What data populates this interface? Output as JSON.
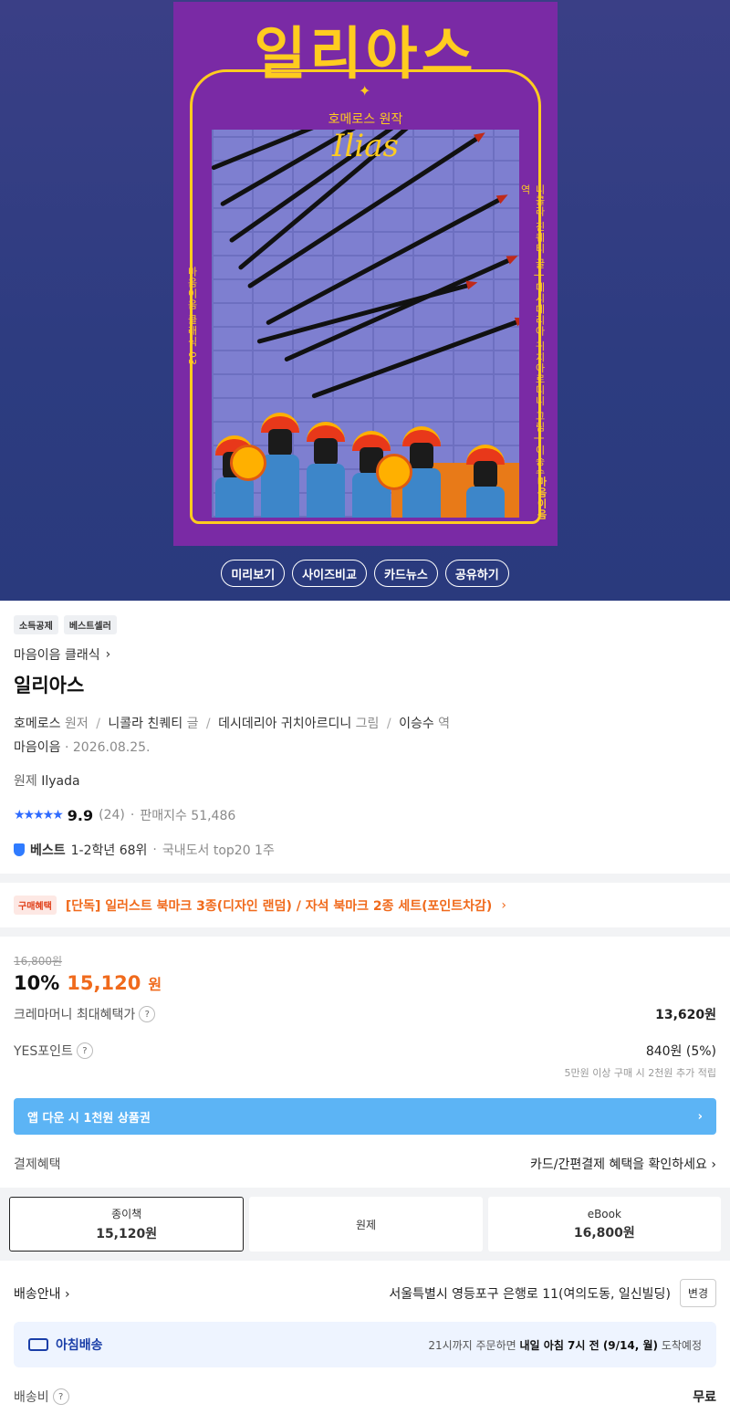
{
  "cover": {
    "title": "일리아스",
    "subtitle": "호메로스 원작",
    "latin_title": "Ilias",
    "spine_left": "마음이음 클래식 03",
    "spine_right": "니콜라 친퀘티 글 | 데시데리아 귀치아르디니 그림 | 이승수 역",
    "publisher_mark": "마음이음"
  },
  "hero_buttons": [
    "미리보기",
    "사이즈비교",
    "카드뉴스",
    "공유하기"
  ],
  "badges": [
    "소득공제",
    "베스트셀러"
  ],
  "series": "마음이음 클래식",
  "title": "일리아스",
  "authors": [
    {
      "name": "호메로스",
      "role": "원저"
    },
    {
      "name": "니콜라 친퀘티",
      "role": "글"
    },
    {
      "name": "데시데리아 귀치아르디니",
      "role": "그림"
    },
    {
      "name": "이승수",
      "role": "역"
    }
  ],
  "publisher": "마음이음",
  "pub_date": "2026.08.25.",
  "original_label": "원제",
  "original_title": "Ilyada",
  "rating": {
    "score": "9.9",
    "count": "(24)",
    "sales_label": "판매지수 51,486"
  },
  "bestseller": {
    "label": "베스트",
    "rank": "1-2학년 68위",
    "extra": "국내도서 top20 1주"
  },
  "benefit": {
    "tag": "구매혜택",
    "text": "[단독] 일러스트 북마크 3종(디자인 랜덤) / 자석 북마크 2종 세트(포인트차감)"
  },
  "price": {
    "original": "16,800원",
    "discount": "10%",
    "sale": "15,120",
    "won": "원",
    "max_benefit_label": "크레마머니 최대혜택가",
    "max_benefit_value": "13,620원",
    "points_label": "YES포인트",
    "points_value": "840원 (5%)",
    "points_note": "5만원 이상 구매 시 2천원 추가 적립",
    "app_banner": "앱 다운 시 1천원 상품권",
    "payment_label": "결제혜택",
    "payment_value": "카드/간편결제 혜택을 확인하세요"
  },
  "formats": [
    {
      "name": "종이책",
      "price": "15,120원"
    },
    {
      "name": "원제",
      "price": ""
    },
    {
      "name": "eBook",
      "price": "16,800원"
    }
  ],
  "shipping": {
    "label": "배송안내",
    "address": "서울특별시 영등포구 은행로 11(여의도동, 일신빌딩)",
    "change": "변경",
    "dawn_label": "아침배송",
    "dawn_prefix": "21시까지 주문하면",
    "dawn_time": "내일 아침 7시 전 (9/14, 월)",
    "dawn_suffix": "도착예정",
    "fee_label": "배송비",
    "fee_value": "무료"
  }
}
